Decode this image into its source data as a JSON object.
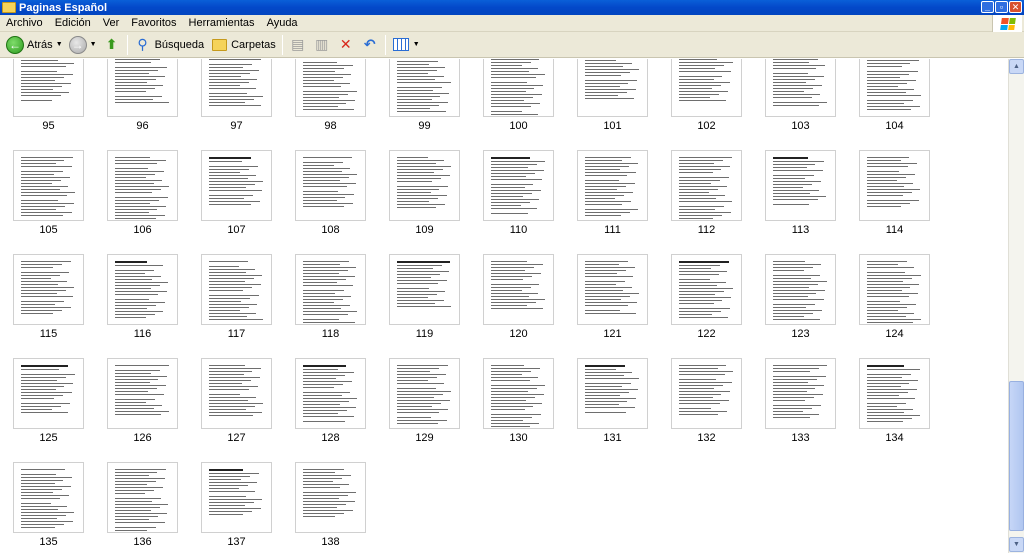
{
  "window": {
    "title": "Paginas Español"
  },
  "window_buttons": [
    "_",
    "▫",
    "✕"
  ],
  "menu": [
    "Archivo",
    "Edición",
    "Ver",
    "Favoritos",
    "Herramientas",
    "Ayuda"
  ],
  "toolbar": {
    "back_label": "Atrás",
    "search_label": "Búsqueda",
    "folders_label": "Carpetas"
  },
  "thumbnails": [
    "95",
    "96",
    "97",
    "98",
    "99",
    "100",
    "101",
    "102",
    "103",
    "104",
    "105",
    "106",
    "107",
    "108",
    "109",
    "110",
    "111",
    "112",
    "113",
    "114",
    "115",
    "116",
    "117",
    "118",
    "119",
    "120",
    "121",
    "122",
    "123",
    "124",
    "125",
    "126",
    "127",
    "128",
    "129",
    "130",
    "131",
    "132",
    "133",
    "134",
    "135",
    "136",
    "137",
    "138"
  ],
  "colors": {
    "titlebar": "#0348c9",
    "chrome": "#ece9d8",
    "close": "#d8512e"
  }
}
